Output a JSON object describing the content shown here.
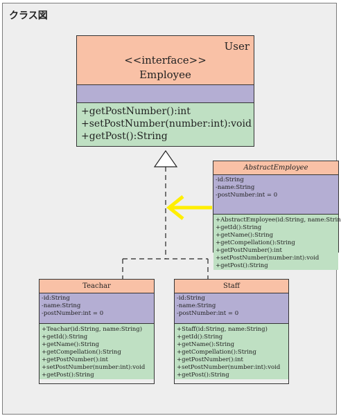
{
  "frame": {
    "title": "クラス図"
  },
  "employee": {
    "stereotype_user": "User",
    "stereotype": "<<interface>>",
    "name": "Employee",
    "operations": [
      "+getPostNumber():int",
      "+setPostNumber(number:int):void",
      "+getPost():String"
    ]
  },
  "abstract_employee": {
    "name": "AbstractEmployee",
    "attributes": [
      "-id:String",
      "-name:String",
      "-postNumber:int = 0"
    ],
    "operations": [
      "+AbstractEmployee(id:String, name:String)",
      "+getId():String",
      "+getName():String",
      "+getCompellation():String",
      "+getPostNumber():int",
      "+setPostNumber(number:int):void",
      "+getPost():String"
    ]
  },
  "teachar": {
    "name": "Teachar",
    "attributes": [
      "-id:String",
      "-name:String",
      "-postNumber:int = 0"
    ],
    "operations": [
      "+Teachar(id:String, name:String)",
      "+getId():String",
      "+getName():String",
      "+getCompellation():String",
      "+getPostNumber():int",
      "+setPostNumber(number:int):void",
      "+getPost():String"
    ]
  },
  "staff": {
    "name": "Staff",
    "attributes": [
      "-id:String",
      "-name:String",
      "-postNumber:int = 0"
    ],
    "operations": [
      "+Staff(id:String, name:String)",
      "+getId():String",
      "+getName():String",
      "+getCompellation():String",
      "+getPostNumber():int",
      "+setPostNumber(number:int):void",
      "+getPost():String"
    ]
  },
  "colors": {
    "header": "#f9c1a6",
    "attributes": "#b4aed3",
    "operations": "#bfe0c3",
    "highlight_arrow": "#ffee00"
  }
}
